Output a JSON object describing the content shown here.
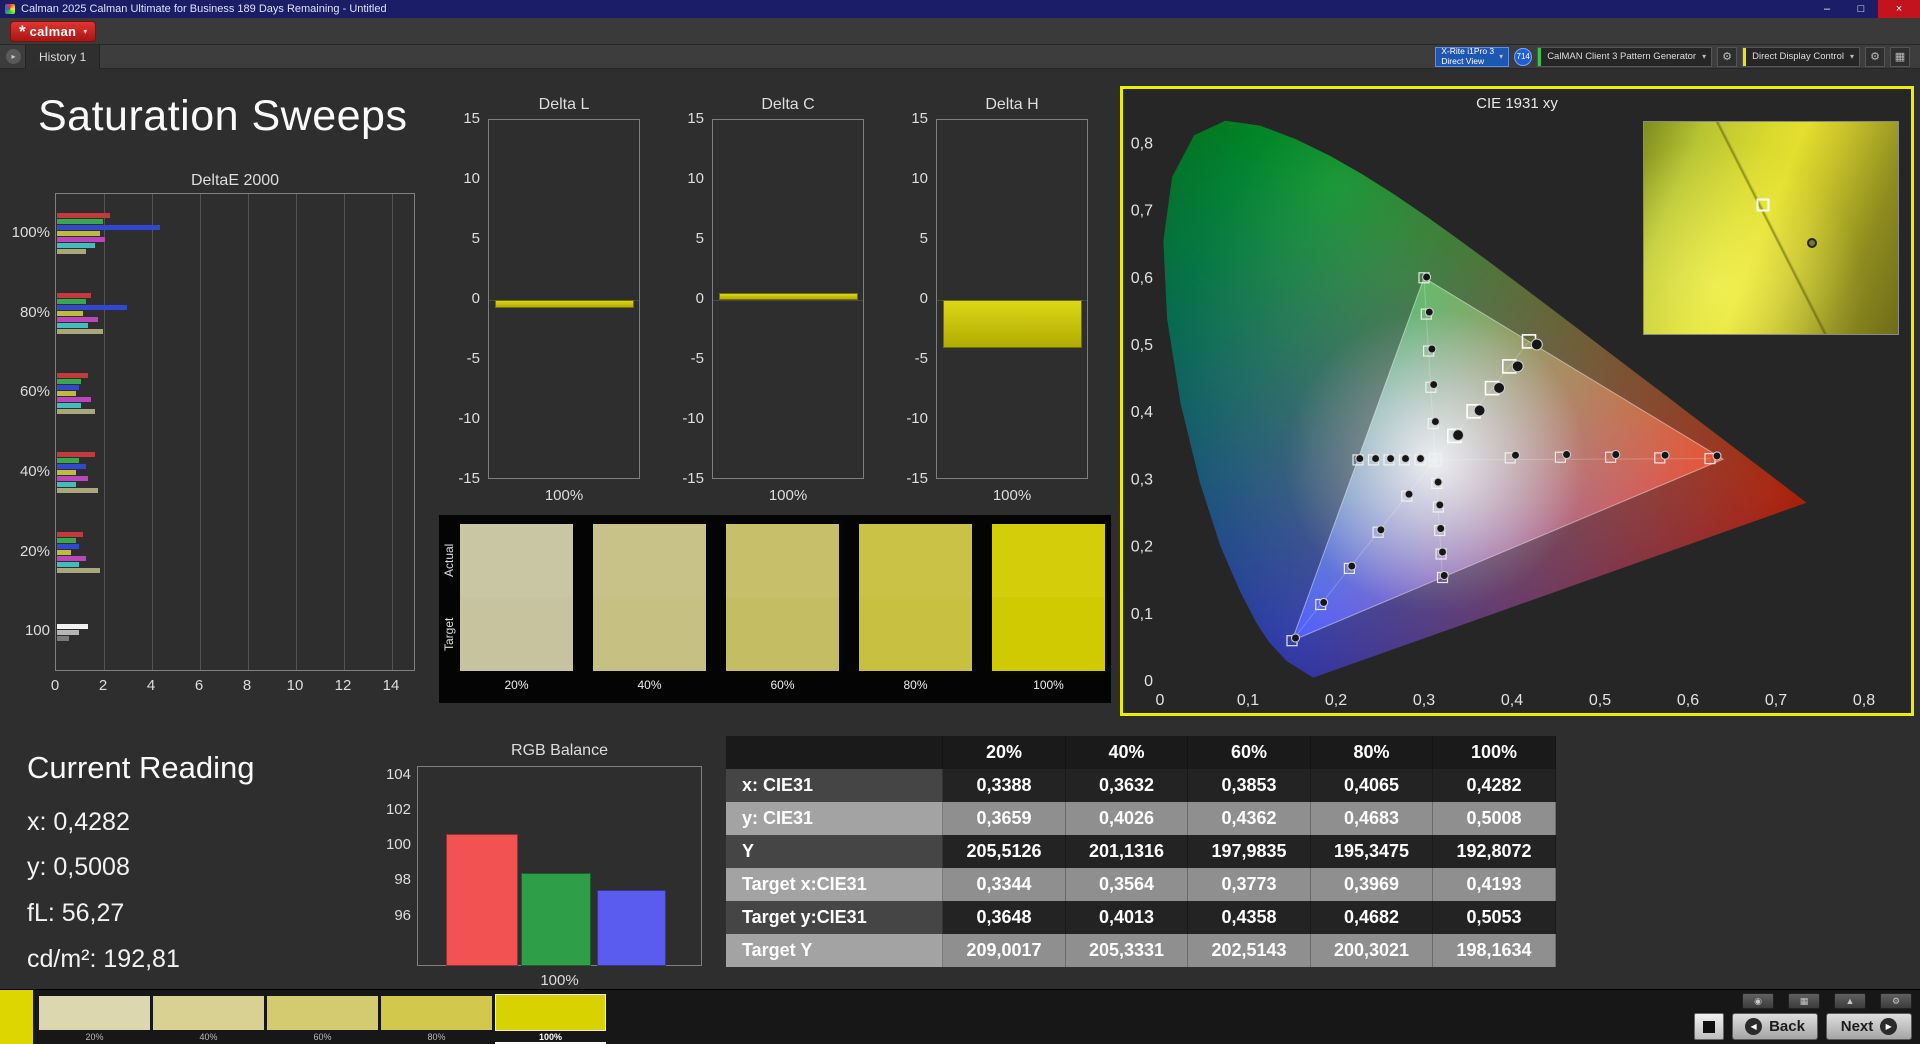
{
  "window": {
    "title": "Calman 2025 Calman Ultimate for Business 189 Days Remaining - Untitled"
  },
  "brand": {
    "logo_text": "calman"
  },
  "nav": {
    "history_tab": "History 1"
  },
  "toolbar": {
    "meter": {
      "line1": "X-Rite i1Pro 3",
      "line2": "Direct View"
    },
    "badge": "714",
    "pattern_generator": "CalMAN Client 3 Pattern Generator",
    "display_control": "Direct Display Control"
  },
  "page": {
    "title": "Saturation Sweeps"
  },
  "current_reading": {
    "heading": "Current Reading",
    "x": "x: 0,4282",
    "y": "y: 0,5008",
    "fl": "fL: 56,27",
    "cdm2": "cd/m²: 192,81"
  },
  "footer": {
    "back": "Back",
    "next": "Next"
  },
  "icons": {
    "logo_mark": "*",
    "dropdown": "▾",
    "gear": "⚙",
    "grid": "▦",
    "camera": "◉",
    "up": "▲",
    "down": "▼",
    "back_arrow": "◀",
    "next_arrow": "▶",
    "tab_chevron": "▸",
    "minimize": "–",
    "maximize": "□",
    "close": "×"
  },
  "swatches": {
    "row_labels": [
      "Actual",
      "Target"
    ],
    "columns": [
      {
        "label": "20%",
        "actual": "#c9c6a4",
        "target": "#c7c39e"
      },
      {
        "label": "40%",
        "actual": "#c8c288",
        "target": "#c6c083"
      },
      {
        "label": "60%",
        "actual": "#c7bf69",
        "target": "#c5bd64"
      },
      {
        "label": "80%",
        "actual": "#c9c247",
        "target": "#c7c041"
      },
      {
        "label": "100%",
        "actual": "#d3cd0a",
        "target": "#d0ca02"
      }
    ]
  },
  "pattern_strip": {
    "current_color": "#ddd600",
    "items": [
      {
        "label": "20%",
        "color": "#dcd7ae",
        "selected": false
      },
      {
        "label": "40%",
        "color": "#d8d192",
        "selected": false
      },
      {
        "label": "60%",
        "color": "#d4cb70",
        "selected": false
      },
      {
        "label": "80%",
        "color": "#d2c94c",
        "selected": false
      },
      {
        "label": "100%",
        "color": "#d8d200",
        "selected": true
      }
    ]
  },
  "chart_data": [
    {
      "id": "deltae",
      "type": "bar",
      "orientation": "horizontal",
      "title": "DeltaE 2000",
      "xmax": 15,
      "xticks": [
        0,
        2,
        4,
        6,
        8,
        10,
        12,
        14
      ],
      "groups": [
        {
          "label": "100%",
          "bars": [
            {
              "c": "#c23a3a",
              "v": 2.2
            },
            {
              "c": "#36a84e",
              "v": 1.9
            },
            {
              "c": "#3347d1",
              "v": 4.3
            },
            {
              "c": "#bcbc3e",
              "v": 1.8
            },
            {
              "c": "#bc44bc",
              "v": 2.0
            },
            {
              "c": "#43bcbc",
              "v": 1.6
            },
            {
              "c": "#a8a87a",
              "v": 1.2
            }
          ]
        },
        {
          "label": "80%",
          "bars": [
            {
              "c": "#c23a3a",
              "v": 1.4
            },
            {
              "c": "#36a84e",
              "v": 1.2
            },
            {
              "c": "#3347d1",
              "v": 2.9
            },
            {
              "c": "#bcbc3e",
              "v": 1.1
            },
            {
              "c": "#bc44bc",
              "v": 1.7
            },
            {
              "c": "#43bcbc",
              "v": 1.3
            },
            {
              "c": "#a8a87a",
              "v": 1.9
            }
          ]
        },
        {
          "label": "60%",
          "bars": [
            {
              "c": "#c23a3a",
              "v": 1.3
            },
            {
              "c": "#36a84e",
              "v": 1.0
            },
            {
              "c": "#3347d1",
              "v": 0.9
            },
            {
              "c": "#bcbc3e",
              "v": 0.8
            },
            {
              "c": "#bc44bc",
              "v": 1.4
            },
            {
              "c": "#43bcbc",
              "v": 1.0
            },
            {
              "c": "#a8a87a",
              "v": 1.6
            }
          ]
        },
        {
          "label": "40%",
          "bars": [
            {
              "c": "#c23a3a",
              "v": 1.6
            },
            {
              "c": "#36a84e",
              "v": 0.9
            },
            {
              "c": "#3347d1",
              "v": 1.2
            },
            {
              "c": "#bcbc3e",
              "v": 0.8
            },
            {
              "c": "#bc44bc",
              "v": 1.3
            },
            {
              "c": "#43bcbc",
              "v": 0.8
            },
            {
              "c": "#a8a87a",
              "v": 1.7
            }
          ]
        },
        {
          "label": "20%",
          "bars": [
            {
              "c": "#c23a3a",
              "v": 1.1
            },
            {
              "c": "#36a84e",
              "v": 0.8
            },
            {
              "c": "#3347d1",
              "v": 0.9
            },
            {
              "c": "#bcbc3e",
              "v": 0.6
            },
            {
              "c": "#bc44bc",
              "v": 1.2
            },
            {
              "c": "#43bcbc",
              "v": 0.9
            },
            {
              "c": "#a8a87a",
              "v": 1.8
            }
          ]
        },
        {
          "label": "100",
          "bars": [
            {
              "c": "#f2f2f2",
              "v": 1.3
            },
            {
              "c": "#b5b5b5",
              "v": 0.9
            },
            {
              "c": "#7a7a7a",
              "v": 0.5
            }
          ]
        }
      ]
    },
    {
      "id": "delta_l",
      "type": "bar",
      "title": "Delta L",
      "xlabel": "100%",
      "ylim": [
        -15,
        15
      ],
      "yticks": [
        15,
        10,
        5,
        0,
        -5,
        -10,
        -15
      ],
      "value": -0.7
    },
    {
      "id": "delta_c",
      "type": "bar",
      "title": "Delta C",
      "xlabel": "100%",
      "ylim": [
        -15,
        15
      ],
      "yticks": [
        15,
        10,
        5,
        0,
        -5,
        -10,
        -15
      ],
      "value": 0.6
    },
    {
      "id": "delta_h",
      "type": "bar",
      "title": "Delta H",
      "xlabel": "100%",
      "ylim": [
        -15,
        15
      ],
      "yticks": [
        15,
        10,
        5,
        0,
        -5,
        -10,
        -15
      ],
      "value": -4.0
    },
    {
      "id": "rgb_balance",
      "type": "bar",
      "title": "RGB Balance",
      "xlabel": "100%",
      "yticks": [
        104,
        102,
        100,
        98,
        96
      ],
      "bars": [
        {
          "c": "#f25252",
          "v": 100.7
        },
        {
          "c": "#2f9e48",
          "v": 98.5
        },
        {
          "c": "#5a5cf0",
          "v": 97.5
        }
      ]
    },
    {
      "id": "cie",
      "type": "scatter",
      "title": "CIE 1931 xy",
      "xticks": [
        [
          0,
          "0"
        ],
        [
          0.1,
          "0,1"
        ],
        [
          0.2,
          "0,2"
        ],
        [
          0.3,
          "0,3"
        ],
        [
          0.4,
          "0,4"
        ],
        [
          0.5,
          "0,5"
        ],
        [
          0.6,
          "0,6"
        ],
        [
          0.7,
          "0,7"
        ],
        [
          0.8,
          "0,8"
        ]
      ],
      "yticks": [
        [
          0,
          "0"
        ],
        [
          0.1,
          "0,1"
        ],
        [
          0.2,
          "0,2"
        ],
        [
          0.3,
          "0,3"
        ],
        [
          0.4,
          "0,4"
        ],
        [
          0.5,
          "0,5"
        ],
        [
          0.6,
          "0,6"
        ],
        [
          0.7,
          "0,7"
        ],
        [
          0.8,
          "0,8"
        ]
      ],
      "white_point": [
        0.3127,
        0.329
      ],
      "gamut_triangle": [
        [
          0.64,
          0.33
        ],
        [
          0.3,
          0.6
        ],
        [
          0.15,
          0.06
        ]
      ],
      "spectral_locus": [
        [
          0.1741,
          0.005
        ],
        [
          0.144,
          0.0297
        ],
        [
          0.1241,
          0.0578
        ],
        [
          0.1096,
          0.0868
        ],
        [
          0.0913,
          0.1327
        ],
        [
          0.0687,
          0.2007
        ],
        [
          0.0454,
          0.295
        ],
        [
          0.0235,
          0.4127
        ],
        [
          0.0082,
          0.5384
        ],
        [
          0.0039,
          0.6548
        ],
        [
          0.0139,
          0.7502
        ],
        [
          0.0389,
          0.812
        ],
        [
          0.0743,
          0.8338
        ],
        [
          0.1142,
          0.8262
        ],
        [
          0.1547,
          0.8059
        ],
        [
          0.1929,
          0.7816
        ],
        [
          0.2296,
          0.7543
        ],
        [
          0.2658,
          0.7243
        ],
        [
          0.3016,
          0.6923
        ],
        [
          0.3373,
          0.6589
        ],
        [
          0.3731,
          0.6245
        ],
        [
          0.4087,
          0.5896
        ],
        [
          0.4441,
          0.5547
        ],
        [
          0.4788,
          0.5202
        ],
        [
          0.5125,
          0.4866
        ],
        [
          0.5448,
          0.4544
        ],
        [
          0.5752,
          0.4242
        ],
        [
          0.6029,
          0.3965
        ],
        [
          0.627,
          0.3725
        ],
        [
          0.6482,
          0.3514
        ],
        [
          0.6658,
          0.334
        ],
        [
          0.6915,
          0.3083
        ],
        [
          0.7079,
          0.292
        ],
        [
          0.719,
          0.2809
        ],
        [
          0.7347,
          0.2653
        ]
      ],
      "sweeps": [
        {
          "name": "yellow",
          "current": true,
          "targets": [
            [
              0.3344,
              0.3648
            ],
            [
              0.3564,
              0.4013
            ],
            [
              0.3773,
              0.4358
            ],
            [
              0.3969,
              0.4682
            ],
            [
              0.4193,
              0.5053
            ]
          ],
          "measured": [
            [
              0.3388,
              0.3659
            ],
            [
              0.3632,
              0.4026
            ],
            [
              0.3853,
              0.4362
            ],
            [
              0.4065,
              0.4683
            ],
            [
              0.4282,
              0.5008
            ]
          ]
        },
        {
          "name": "red",
          "current": false,
          "targets": [
            [
              0.398,
              0.332
            ],
            [
              0.455,
              0.333
            ],
            [
              0.512,
              0.333
            ],
            [
              0.568,
              0.332
            ],
            [
              0.625,
              0.331
            ]
          ],
          "measured": [
            [
              0.404,
              0.336
            ],
            [
              0.462,
              0.337
            ],
            [
              0.518,
              0.337
            ],
            [
              0.574,
              0.336
            ],
            [
              0.633,
              0.335
            ]
          ]
        },
        {
          "name": "green",
          "current": false,
          "targets": [
            [
              0.3104,
              0.383
            ],
            [
              0.3078,
              0.437
            ],
            [
              0.3052,
              0.491
            ],
            [
              0.3026,
              0.546
            ],
            [
              0.3,
              0.6
            ]
          ],
          "measured": [
            [
              0.313,
              0.386
            ],
            [
              0.311,
              0.441
            ],
            [
              0.309,
              0.494
            ],
            [
              0.306,
              0.549
            ],
            [
              0.303,
              0.601
            ]
          ]
        },
        {
          "name": "blue",
          "current": false,
          "targets": [
            [
              0.2804,
              0.2752
            ],
            [
              0.2478,
              0.2214
            ],
            [
              0.2152,
              0.1676
            ],
            [
              0.1826,
              0.1138
            ],
            [
              0.15,
              0.06
            ]
          ],
          "measured": [
            [
              0.283,
              0.278
            ],
            [
              0.251,
              0.225
            ],
            [
              0.218,
              0.171
            ],
            [
              0.186,
              0.117
            ],
            [
              0.154,
              0.064
            ]
          ]
        },
        {
          "name": "cyan",
          "current": false,
          "targets": [
            [
              0.2954,
              0.329
            ],
            [
              0.2778,
              0.329
            ],
            [
              0.2602,
              0.329
            ],
            [
              0.2426,
              0.329
            ],
            [
              0.225,
              0.329
            ]
          ],
          "measured": [
            [
              0.296,
              0.331
            ],
            [
              0.279,
              0.331
            ],
            [
              0.262,
              0.331
            ],
            [
              0.245,
              0.331
            ],
            [
              0.227,
              0.331
            ]
          ]
        },
        {
          "name": "magenta",
          "current": false,
          "targets": [
            [
              0.3146,
              0.294
            ],
            [
              0.3162,
              0.259
            ],
            [
              0.3178,
              0.224
            ],
            [
              0.3194,
              0.189
            ],
            [
              0.321,
              0.154
            ]
          ],
          "measured": [
            [
              0.316,
              0.296
            ],
            [
              0.318,
              0.262
            ],
            [
              0.319,
              0.227
            ],
            [
              0.321,
              0.192
            ],
            [
              0.323,
              0.157
            ]
          ]
        }
      ],
      "inset": {
        "square": [
          47,
          39
        ],
        "circle": [
          66,
          57
        ]
      }
    },
    {
      "id": "sat_table",
      "type": "table",
      "columns": [
        "20%",
        "40%",
        "60%",
        "80%",
        "100%"
      ],
      "rows": [
        {
          "label": "x: CIE31",
          "values": [
            "0,3388",
            "0,3632",
            "0,3853",
            "0,4065",
            "0,4282"
          ]
        },
        {
          "label": "y: CIE31",
          "values": [
            "0,3659",
            "0,4026",
            "0,4362",
            "0,4683",
            "0,5008"
          ]
        },
        {
          "label": "Y",
          "values": [
            "205,5126",
            "201,1316",
            "197,9835",
            "195,3475",
            "192,8072"
          ]
        },
        {
          "label": "Target x:CIE31",
          "values": [
            "0,3344",
            "0,3564",
            "0,3773",
            "0,3969",
            "0,4193"
          ]
        },
        {
          "label": "Target y:CIE31",
          "values": [
            "0,3648",
            "0,4013",
            "0,4358",
            "0,4682",
            "0,5053"
          ]
        },
        {
          "label": "Target Y",
          "values": [
            "209,0017",
            "205,3331",
            "202,5143",
            "200,3021",
            "198,1634"
          ]
        }
      ]
    }
  ]
}
